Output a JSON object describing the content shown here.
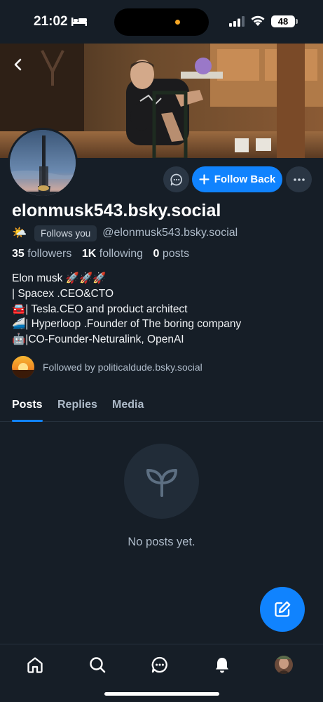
{
  "status_bar": {
    "time": "21:02",
    "battery": "48"
  },
  "profile": {
    "display_name": "elonmusk543.bsky.social",
    "follows_you": "Follows you",
    "handle": "@elonmusk543.bsky.social",
    "stats": {
      "followers_count": "35",
      "followers_label": "followers",
      "following_count": "1K",
      "following_label": "following",
      "posts_count": "0",
      "posts_label": "posts"
    },
    "bio": "Elon musk 🚀🚀🚀\n| Spacex .CEO&CTO\n🚘| Tesla.CEO and product architect\n🚄| Hyperloop .Founder of The boring company\n🤖|CO-Founder-Neturalink, OpenAI",
    "followed_by": "Followed by politicaldude.bsky.social",
    "follow_button_label": "Follow Back"
  },
  "tabs": [
    {
      "label": "Posts",
      "active": true
    },
    {
      "label": "Replies",
      "active": false
    },
    {
      "label": "Media",
      "active": false
    }
  ],
  "empty_state": {
    "text": "No posts yet.",
    "icon": "sprout-icon"
  },
  "nav": {
    "items": [
      "home-icon",
      "search-icon",
      "chat-icon",
      "bell-icon",
      "profile-avatar"
    ]
  },
  "colors": {
    "accent": "#1083fe",
    "background": "#161e27"
  }
}
